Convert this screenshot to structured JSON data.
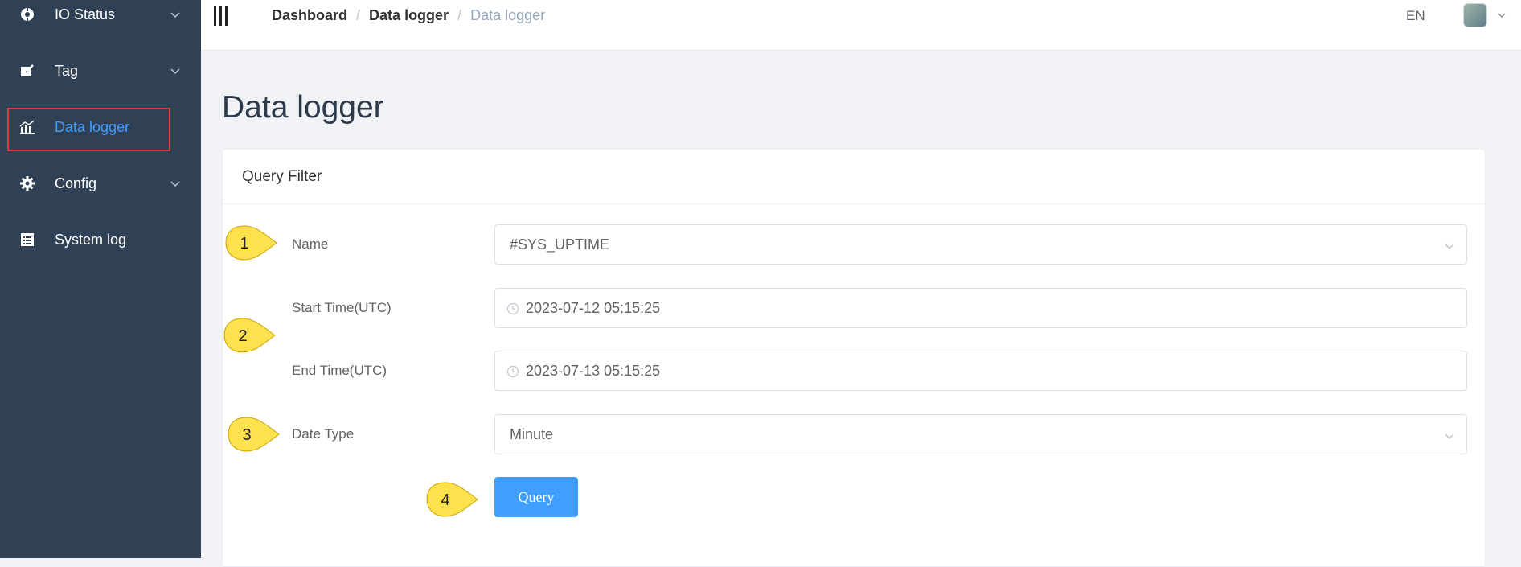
{
  "sidebar": {
    "items": [
      {
        "label": "IO Status",
        "icon": "io-status-icon",
        "has_chevron": true
      },
      {
        "label": "Tag",
        "icon": "tag-icon",
        "has_chevron": true
      },
      {
        "label": "Data logger",
        "icon": "chart-icon",
        "active": true
      },
      {
        "label": "Config",
        "icon": "gear-icon",
        "has_chevron": true
      },
      {
        "label": "System log",
        "icon": "list-icon"
      }
    ]
  },
  "header": {
    "breadcrumb": [
      "Dashboard",
      "Data logger",
      "Data logger"
    ],
    "language": "EN"
  },
  "page": {
    "title": "Data logger"
  },
  "filter": {
    "title": "Query Filter",
    "name": {
      "label": "Name",
      "value": "#SYS_UPTIME"
    },
    "start_time": {
      "label": "Start Time(UTC)",
      "value": "2023-07-12 05:15:25"
    },
    "end_time": {
      "label": "End Time(UTC)",
      "value": "2023-07-13 05:15:25"
    },
    "date_type": {
      "label": "Date Type",
      "value": "Minute"
    },
    "query_label": "Query"
  },
  "callouts": [
    "1",
    "2",
    "3",
    "4"
  ],
  "colors": {
    "sidebar_bg": "#304156",
    "accent": "#409eff",
    "highlight_box": "#e0393e",
    "callout_fill": "#ffe14d"
  }
}
